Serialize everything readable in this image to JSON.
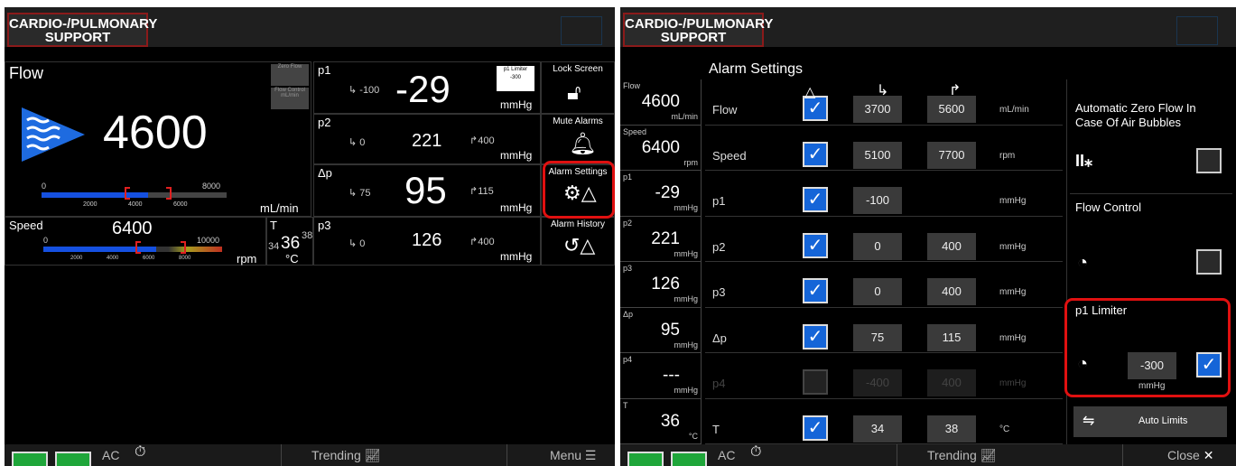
{
  "logo": {
    "line1": "CARDIO-/PULMONARY",
    "line2": "SUPPORT"
  },
  "left": {
    "flow": {
      "label": "Flow",
      "value": "4600",
      "unit": "mL/min",
      "scale_min": "0",
      "scale_max": "8000",
      "ticks": [
        "2000",
        "4000",
        "6000"
      ],
      "zero_flow": "Zero Flow",
      "flow_control": "Flow Control",
      "mlmin": "mL/min"
    },
    "speed": {
      "label": "Speed",
      "value": "6400",
      "unit": "rpm",
      "scale_min": "0",
      "scale_max": "10000",
      "ticks": [
        "2000",
        "4000",
        "6000",
        "8000"
      ]
    },
    "temp": {
      "label": "T",
      "low": "34",
      "value": "36",
      "high": "38",
      "unit": "°C"
    },
    "p1": {
      "label": "p1",
      "low": "-100",
      "value": "-29",
      "unit": "mmHg",
      "limiter_label": "p1 Limiter",
      "limiter_value": "-300"
    },
    "p2": {
      "label": "p2",
      "low": "0",
      "value": "221",
      "high": "400",
      "unit": "mmHg"
    },
    "dp": {
      "label": "Δp",
      "low": "75",
      "value": "95",
      "high": "115",
      "unit": "mmHg"
    },
    "p3": {
      "label": "p3",
      "low": "0",
      "value": "126",
      "high": "400",
      "unit": "mmHg"
    },
    "buttons": {
      "lock": "Lock Screen",
      "mute": "Mute Alarms",
      "alarm_settings": "Alarm Settings",
      "alarm_history": "Alarm History"
    },
    "bottom": {
      "ac": "AC",
      "trending": "Trending",
      "menu": "Menu"
    }
  },
  "right": {
    "title": "Alarm Settings",
    "side": [
      {
        "label": "Flow",
        "value": "4600",
        "unit": "mL/min"
      },
      {
        "label": "Speed",
        "value": "6400",
        "unit": "rpm"
      },
      {
        "label": "p1",
        "value": "-29",
        "unit": "mmHg"
      },
      {
        "label": "p2",
        "value": "221",
        "unit": "mmHg"
      },
      {
        "label": "p3",
        "value": "126",
        "unit": "mmHg"
      },
      {
        "label": "Δp",
        "value": "95",
        "unit": "mmHg"
      },
      {
        "label": "p4",
        "value": "---",
        "unit": "mmHg"
      },
      {
        "label": "T",
        "value": "36",
        "unit": "°C"
      }
    ],
    "rows": [
      {
        "name": "Flow",
        "low": "3700",
        "high": "5600",
        "unit": "mL/min",
        "state": "on"
      },
      {
        "name": "Speed",
        "low": "5100",
        "high": "7700",
        "unit": "rpm",
        "state": "on"
      },
      {
        "name": "p1",
        "low": "-100",
        "high": "",
        "unit": "mmHg",
        "state": "on"
      },
      {
        "name": "p2",
        "low": "0",
        "high": "400",
        "unit": "mmHg",
        "state": "on"
      },
      {
        "name": "p3",
        "low": "0",
        "high": "400",
        "unit": "mmHg",
        "state": "on"
      },
      {
        "name": "Δp",
        "low": "75",
        "high": "115",
        "unit": "mmHg",
        "state": "on"
      },
      {
        "name": "p4",
        "low": "-400",
        "high": "400",
        "unit": "mmHg",
        "state": "disabled"
      },
      {
        "name": "T",
        "low": "34",
        "high": "38",
        "unit": "°C",
        "state": "on"
      }
    ],
    "settings": {
      "azf_line1": "Automatic Zero Flow In",
      "azf_line2": "Case Of Air Bubbles",
      "flow_control": "Flow Control",
      "p1_limiter": "p1 Limiter",
      "p1_limiter_value": "-300",
      "p1_limiter_unit": "mmHg",
      "auto_limits": "Auto Limits"
    },
    "bottom": {
      "ac": "AC",
      "trending": "Trending",
      "close": "Close"
    }
  }
}
